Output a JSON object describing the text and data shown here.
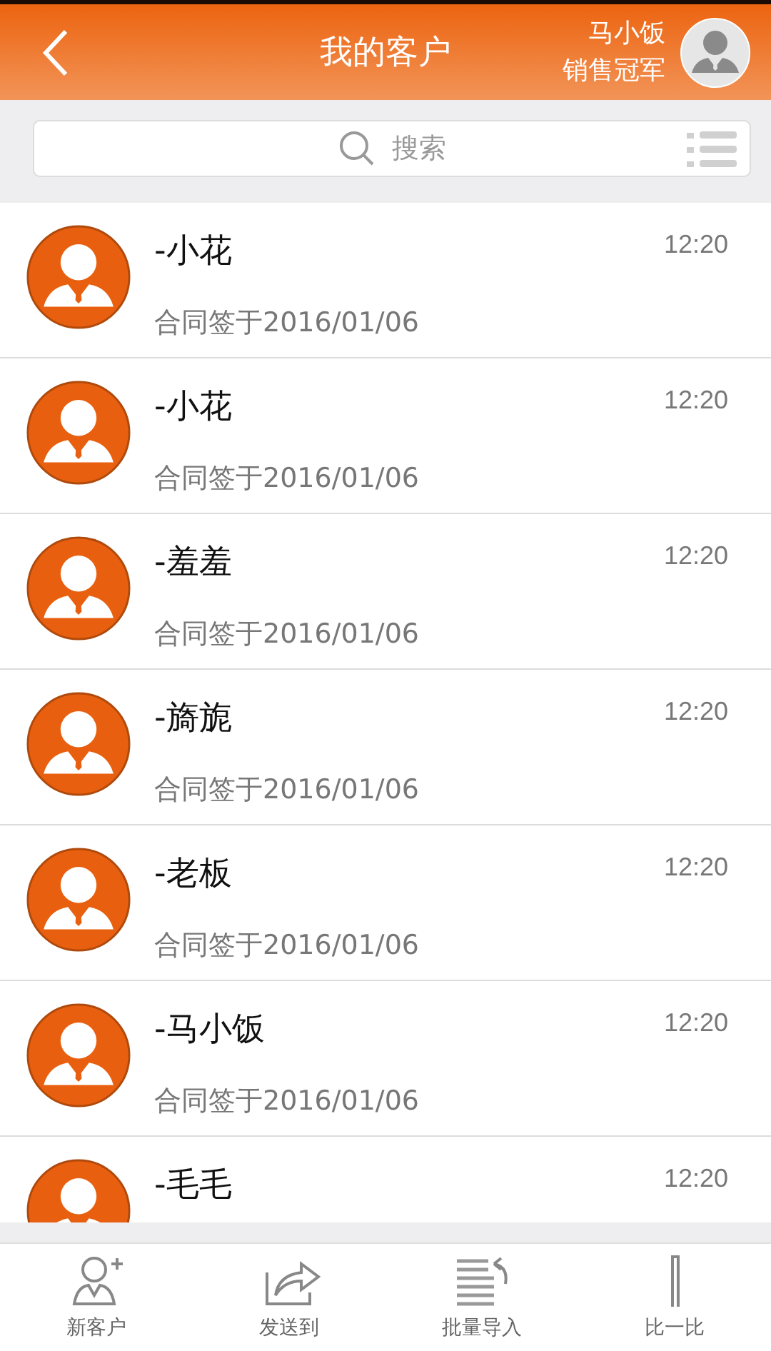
{
  "header": {
    "title": "我的客户",
    "user_name": "马小饭",
    "user_title": "销售冠军"
  },
  "search": {
    "placeholder": "搜索"
  },
  "customers": [
    {
      "name": "-小花",
      "date": "合同签于2016/01/06",
      "time": "12:20"
    },
    {
      "name": "-小花",
      "date": "合同签于2016/01/06",
      "time": "12:20"
    },
    {
      "name": "-羞羞",
      "date": "合同签于2016/01/06",
      "time": "12:20"
    },
    {
      "name": "-旖旎",
      "date": "合同签于2016/01/06",
      "time": "12:20"
    },
    {
      "name": "-老板",
      "date": "合同签于2016/01/06",
      "time": "12:20"
    },
    {
      "name": "-马小饭",
      "date": "合同签于2016/01/06",
      "time": "12:20"
    },
    {
      "name": "-毛毛",
      "time": "12:20"
    }
  ],
  "bottom_bar": [
    {
      "kind": "new",
      "label": "新客户"
    },
    {
      "kind": "send",
      "label": "发送到"
    },
    {
      "kind": "import",
      "label": "批量导入"
    },
    {
      "kind": "compare",
      "label": "比一比"
    }
  ]
}
